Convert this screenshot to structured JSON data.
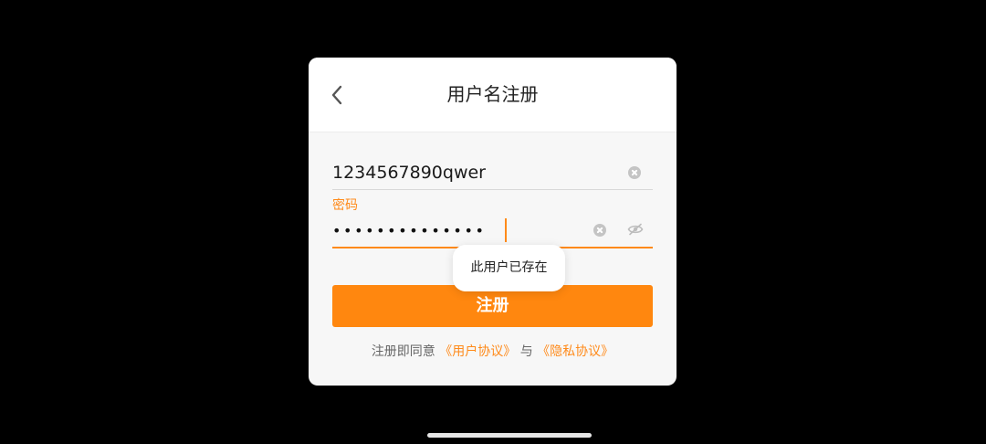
{
  "dialog": {
    "title": "用户名注册",
    "back_icon": "chevron-left-icon"
  },
  "form": {
    "username": {
      "value": "1234567890qwer",
      "clear_icon": "clear-circle-icon"
    },
    "password": {
      "label": "密码",
      "masked_value": "••••••••••••••",
      "clear_icon": "clear-circle-icon",
      "visibility_icon": "eye-hidden-icon"
    }
  },
  "toast": {
    "message": "此用户已存在"
  },
  "register_button": {
    "label": "注册"
  },
  "agreement": {
    "prefix": "注册即同意",
    "user_agreement": "《用户协议》",
    "conjunction": "与",
    "privacy_agreement": "《隐私协议》"
  },
  "colors": {
    "accent": "#ff870f",
    "background": "#000000",
    "dialog": "#f7f7f7"
  }
}
